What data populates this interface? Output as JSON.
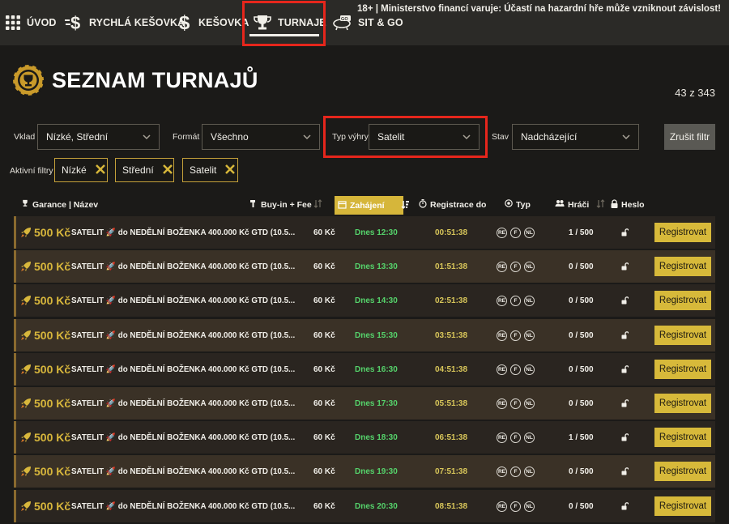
{
  "nav": {
    "items": [
      {
        "label": "ÚVOD",
        "icon": "grid-icon"
      },
      {
        "label": "RYCHLÁ KEŠOVKA",
        "icon": "fast-dollar-icon"
      },
      {
        "label": "KEŠOVKA",
        "icon": "dollar-icon"
      },
      {
        "label": "TURNAJE",
        "icon": "trophy-icon",
        "active": true
      },
      {
        "label": "SIT & GO",
        "icon": "sitgo-icon"
      }
    ],
    "warning": "18+ | Ministerstvo financí varuje: Účastí na hazardní hře může vzniknout závislost!"
  },
  "header": {
    "title": "SEZNAM TURNAJŮ",
    "count": "43 z 343"
  },
  "filters": {
    "deposit": {
      "label": "Vklad",
      "value": "Nízké, Střední"
    },
    "format": {
      "label": "Formát",
      "value": "Všechno"
    },
    "prize_type": {
      "label": "Typ výhry",
      "value": "Satelit"
    },
    "state": {
      "label": "Stav",
      "value": "Nadcházející"
    },
    "clear_label": "Zrušit filtr",
    "active_label": "Aktivní filtry",
    "chips": [
      "Nízké",
      "Střední",
      "Satelit"
    ]
  },
  "table": {
    "headers": {
      "name": "Garance | Název",
      "buyin": "Buy-in + Fee",
      "start": "Zahájení",
      "registration": "Registrace do",
      "type": "Typ",
      "players": "Hráči",
      "password": "Heslo"
    },
    "type_badges": [
      "RE",
      "F",
      "NL"
    ],
    "button_label": "Registrovat",
    "rows": [
      {
        "prize": "500 Kč",
        "name": "SATELIT 🚀 do NEDĚLNÍ BOŽENKA 400.000 Kč GTD (10.5...",
        "buyin": "60 Kč",
        "start": "Dnes 12:30",
        "reg": "00:51:38",
        "players": "1 / 500"
      },
      {
        "prize": "500 Kč",
        "name": "SATELIT 🚀 do NEDĚLNÍ BOŽENKA 400.000 Kč GTD (10.5...",
        "buyin": "60 Kč",
        "start": "Dnes 13:30",
        "reg": "01:51:38",
        "players": "0 / 500"
      },
      {
        "prize": "500 Kč",
        "name": "SATELIT 🚀 do NEDĚLNÍ BOŽENKA 400.000 Kč GTD (10.5...",
        "buyin": "60 Kč",
        "start": "Dnes 14:30",
        "reg": "02:51:38",
        "players": "0 / 500"
      },
      {
        "prize": "500 Kč",
        "name": "SATELIT 🚀 do NEDĚLNÍ BOŽENKA 400.000 Kč GTD (10.5...",
        "buyin": "60 Kč",
        "start": "Dnes 15:30",
        "reg": "03:51:38",
        "players": "0 / 500"
      },
      {
        "prize": "500 Kč",
        "name": "SATELIT 🚀 do NEDĚLNÍ BOŽENKA 400.000 Kč GTD (10.5...",
        "buyin": "60 Kč",
        "start": "Dnes 16:30",
        "reg": "04:51:38",
        "players": "0 / 500"
      },
      {
        "prize": "500 Kč",
        "name": "SATELIT 🚀 do NEDĚLNÍ BOŽENKA 400.000 Kč GTD (10.5...",
        "buyin": "60 Kč",
        "start": "Dnes 17:30",
        "reg": "05:51:38",
        "players": "0 / 500"
      },
      {
        "prize": "500 Kč",
        "name": "SATELIT 🚀 do NEDĚLNÍ BOŽENKA 400.000 Kč GTD (10.5...",
        "buyin": "60 Kč",
        "start": "Dnes 18:30",
        "reg": "06:51:38",
        "players": "1 / 500"
      },
      {
        "prize": "500 Kč",
        "name": "SATELIT 🚀 do NEDĚLNÍ BOŽENKA 400.000 Kč GTD (10.5...",
        "buyin": "60 Kč",
        "start": "Dnes 19:30",
        "reg": "07:51:38",
        "players": "0 / 500"
      },
      {
        "prize": "500 Kč",
        "name": "SATELIT 🚀 do NEDĚLNÍ BOŽENKA 400.000 Kč GTD (10.5...",
        "buyin": "60 Kč",
        "start": "Dnes 20:30",
        "reg": "08:51:38",
        "players": "0 / 500"
      }
    ]
  }
}
